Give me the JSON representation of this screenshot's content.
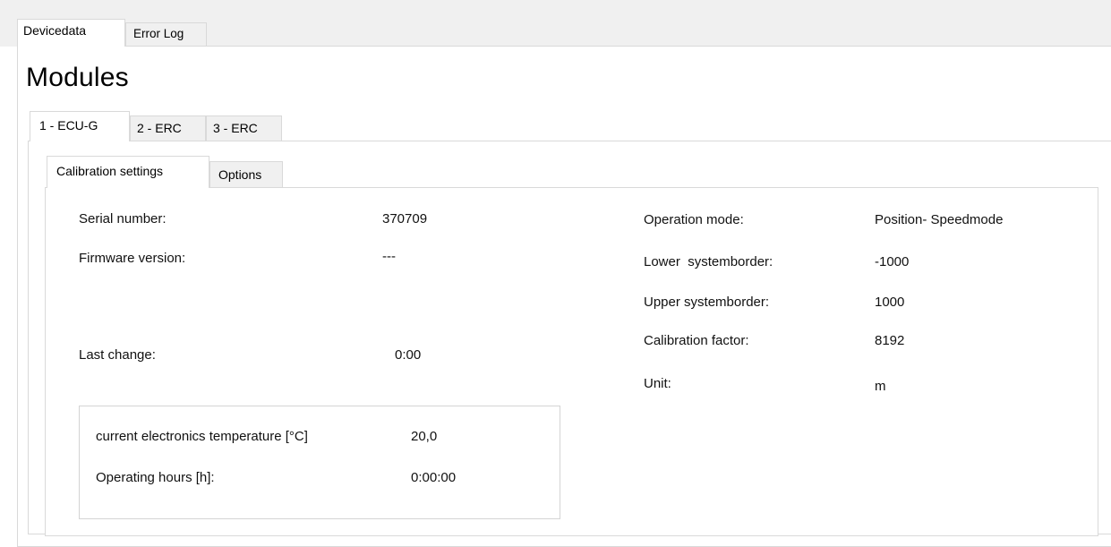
{
  "top_tabs": [
    {
      "label": "Devicedata",
      "active": true
    },
    {
      "label": "Error Log",
      "active": false
    }
  ],
  "page_title": "Modules",
  "module_tabs": [
    {
      "label": "1 - ECU-G",
      "active": true
    },
    {
      "label": "2 - ERC",
      "active": false
    },
    {
      "label": "3 - ERC",
      "active": false
    }
  ],
  "sub_tabs": [
    {
      "label": "Calibration settings",
      "active": true
    },
    {
      "label": "Options",
      "active": false
    }
  ],
  "left_fields": {
    "serial_number": {
      "label": "Serial number:",
      "value": "370709"
    },
    "firmware_version": {
      "label": "Firmware version:",
      "value": "---"
    },
    "last_change": {
      "label": "Last change:",
      "value": "0:00"
    }
  },
  "right_fields": {
    "operation_mode": {
      "label": "Operation mode:",
      "value": "Position- Speedmode"
    },
    "lower_systemborder": {
      "label": "Lower  systemborder:",
      "value": "-1000"
    },
    "upper_systemborder": {
      "label": "Upper systemborder:",
      "value": "1000"
    },
    "calibration_factor": {
      "label": "Calibration factor:",
      "value": "8192"
    },
    "unit": {
      "label": "Unit:",
      "value": "m"
    }
  },
  "status_box": {
    "temperature": {
      "label": "current electronics temperature [°C]",
      "value": "20,0"
    },
    "operating_hours": {
      "label": "Operating hours [h]:",
      "value": "0:00:00"
    }
  }
}
